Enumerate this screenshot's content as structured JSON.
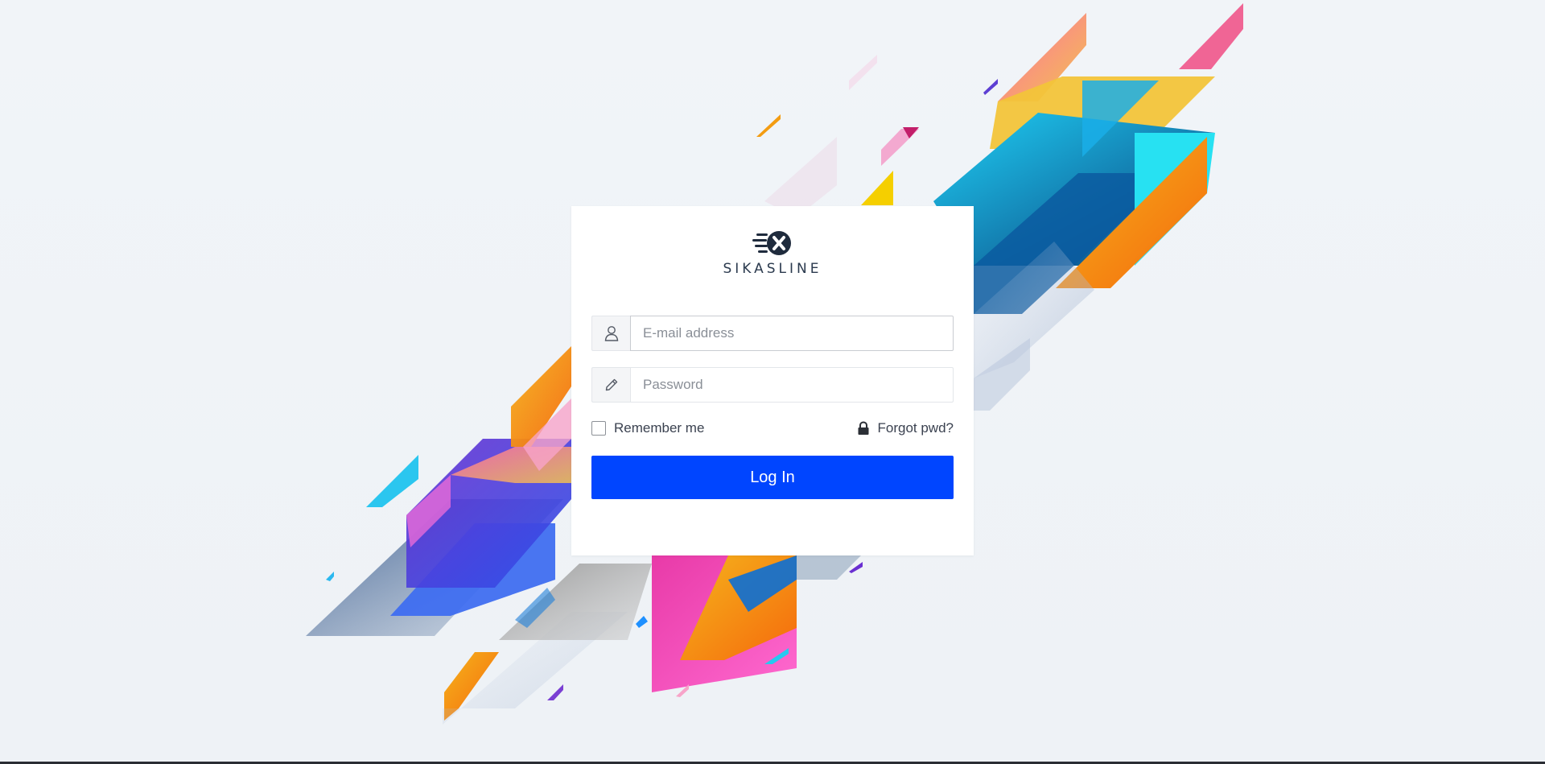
{
  "brand": {
    "name": "SIKASLINE",
    "logo_icon": "speed-x-logo-icon",
    "text_color": "#2b3a4e"
  },
  "login_form": {
    "email": {
      "icon": "user-icon",
      "placeholder": "E-mail address",
      "value": ""
    },
    "password": {
      "icon": "pencil-icon",
      "placeholder": "Password",
      "value": ""
    },
    "remember_label": "Remember me",
    "remember_checked": false,
    "forgot_icon": "lock-icon",
    "forgot_label": "Forgot pwd?",
    "submit_label": "Log In"
  },
  "colors": {
    "primary_button": "#0045ff",
    "page_background": "#eef2f7",
    "card_background": "#ffffff"
  }
}
